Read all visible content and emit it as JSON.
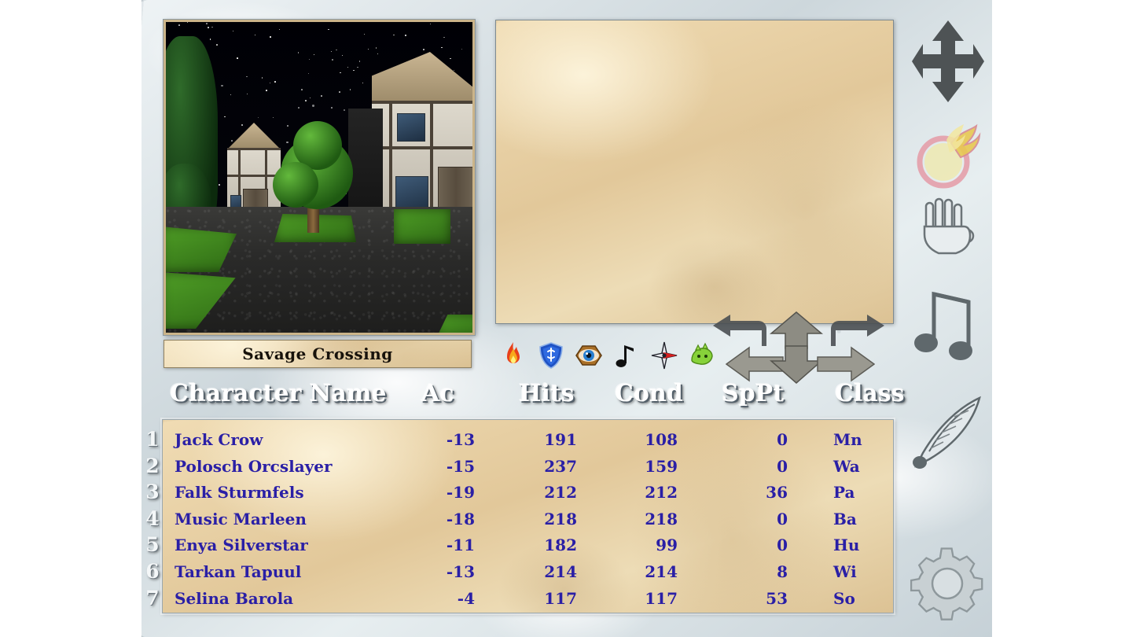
{
  "viewport": {
    "name": "3d-scene-viewport",
    "scene_description": "Night-time village street with timber-framed houses, trees and cobblestone path"
  },
  "message_panel": {
    "name": "message-parchment",
    "text": ""
  },
  "location": {
    "label": "Savage Crossing"
  },
  "action_bar": {
    "icons": [
      {
        "id": "fire-torch-icon",
        "label": "Light / Torch"
      },
      {
        "id": "shield-heal-icon",
        "label": "Heal / Protection"
      },
      {
        "id": "eye-detect-icon",
        "label": "Detect / Search"
      },
      {
        "id": "music-note-icon",
        "label": "Play Music"
      },
      {
        "id": "compass-icon",
        "label": "Compass / Navigate"
      },
      {
        "id": "green-creature-icon",
        "label": "Creature"
      }
    ]
  },
  "movement": {
    "controls": [
      {
        "id": "turn-left-arrow",
        "label": "Turn Left"
      },
      {
        "id": "forward-arrow",
        "label": "Move Forward"
      },
      {
        "id": "turn-right-arrow",
        "label": "Turn Right"
      },
      {
        "id": "strafe-left-arrow",
        "label": "Strafe Left"
      },
      {
        "id": "backward-arrow",
        "label": "Move Backward"
      },
      {
        "id": "strafe-right-arrow",
        "label": "Strafe Right"
      }
    ]
  },
  "sidebar": {
    "items": [
      {
        "id": "four-way-arrow-icon",
        "label": "Movement"
      },
      {
        "id": "fireball-icon",
        "label": "Magic"
      },
      {
        "id": "open-hand-icon",
        "label": "Use / Touch"
      },
      {
        "id": "double-music-note-icon",
        "label": "Music"
      },
      {
        "id": "quill-pen-icon",
        "label": "Notes"
      },
      {
        "id": "gear-icon",
        "label": "Options"
      }
    ]
  },
  "roster": {
    "columns": [
      {
        "key": "name",
        "label": "Character Name"
      },
      {
        "key": "ac",
        "label": "Ac"
      },
      {
        "key": "hits",
        "label": "Hits"
      },
      {
        "key": "cond",
        "label": "Cond"
      },
      {
        "key": "sppt",
        "label": "SpPt"
      },
      {
        "key": "class",
        "label": "Class"
      }
    ],
    "rows": [
      {
        "num": "1",
        "name": "Jack Crow",
        "ac": "-13",
        "hits": "191",
        "cond": "108",
        "sppt": "0",
        "class": "Mn"
      },
      {
        "num": "2",
        "name": "Polosch Orcslayer",
        "ac": "-15",
        "hits": "237",
        "cond": "159",
        "sppt": "0",
        "class": "Wa"
      },
      {
        "num": "3",
        "name": "Falk Sturmfels",
        "ac": "-19",
        "hits": "212",
        "cond": "212",
        "sppt": "36",
        "class": "Pa"
      },
      {
        "num": "4",
        "name": "Music Marleen",
        "ac": "-18",
        "hits": "218",
        "cond": "218",
        "sppt": "0",
        "class": "Ba"
      },
      {
        "num": "5",
        "name": "Enya Silverstar",
        "ac": "-11",
        "hits": "182",
        "cond": "99",
        "sppt": "0",
        "class": "Hu"
      },
      {
        "num": "6",
        "name": "Tarkan Tapuul",
        "ac": "-13",
        "hits": "214",
        "cond": "214",
        "sppt": "8",
        "class": "Wi"
      },
      {
        "num": "7",
        "name": "Selina Barola",
        "ac": "-4",
        "hits": "117",
        "cond": "117",
        "sppt": "53",
        "class": "So"
      }
    ]
  },
  "colors": {
    "parchment": "#e6cfa4",
    "text_blue": "#2a1fa6",
    "header_white": "#ffffff",
    "marble": "#d8dfe2"
  }
}
